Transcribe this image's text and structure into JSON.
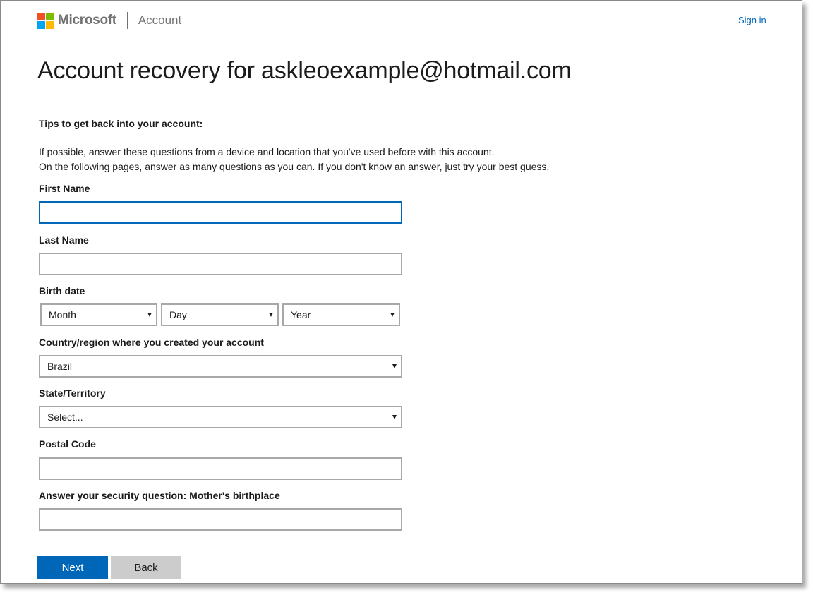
{
  "header": {
    "brand": "Microsoft",
    "section": "Account",
    "sign_in": "Sign in",
    "logo_colors": [
      "#f25022",
      "#7fba00",
      "#00a4ef",
      "#ffb900"
    ]
  },
  "page": {
    "title": "Account recovery for askleoexample@hotmail.com",
    "tips_heading": "Tips to get back into your account:",
    "tips_line1": "If possible, answer these questions from a device and location that you've used before with this account.",
    "tips_line2": "On the following pages, answer as many questions as you can. If you don't know an answer, just try your best guess."
  },
  "form": {
    "first_name": {
      "label": "First Name",
      "value": ""
    },
    "last_name": {
      "label": "Last Name",
      "value": ""
    },
    "birth_date": {
      "label": "Birth date",
      "month": "Month",
      "day": "Day",
      "year": "Year"
    },
    "country": {
      "label": "Country/region where you created your account",
      "value": "Brazil"
    },
    "state": {
      "label": "State/Territory",
      "value": "Select..."
    },
    "postal_code": {
      "label": "Postal Code",
      "value": ""
    },
    "security_question": {
      "label": "Answer your security question: Mother's birthplace",
      "value": ""
    }
  },
  "actions": {
    "next": "Next",
    "back": "Back"
  },
  "colors": {
    "accent": "#0067b8",
    "secondary_button": "#cccccc",
    "input_border": "#a8a8a8"
  }
}
